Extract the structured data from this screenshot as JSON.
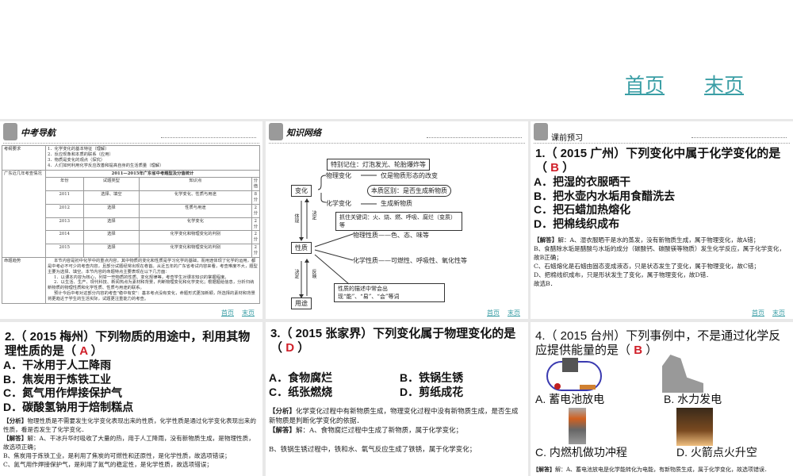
{
  "top_nav": {
    "first": "首页",
    "last": "末页"
  },
  "panel1": {
    "title": "中考导航",
    "req_label": "考纲要求",
    "req_items": [
      "1．化学变化的基本特征（理解）",
      "2．反应现象和本质的联系（应用）",
      "3．物质是变化的观点（探究）",
      "4．人们如何利用化学反应改善和提高自身的生活质量（理解）"
    ],
    "recent_label": "广东近几年考查情况",
    "table_title": "2011—2015年广东省中考题型及分值统计",
    "headers": [
      "年份",
      "试题类型",
      "知识点",
      "分值"
    ],
    "rows": [
      [
        "2011",
        "选择、填空",
        "化学变化、性质与用途",
        "8分"
      ],
      [
        "2012",
        "选择",
        "性质与用途",
        "2分"
      ],
      [
        "2013",
        "选择",
        "化学变化",
        "2分"
      ],
      [
        "2014",
        "选择",
        "化学变化和物理变化的判别",
        "2分"
      ],
      [
        "2015",
        "选择",
        "化学变化和物理变化的判别",
        "2分"
      ]
    ],
    "trend_label": "命题趋势",
    "trend_paras": [
      "本节内容是初中化学中的重点内容，其中物质的变化和性质是学习化学的基础，而用途体现了化学的运用，都是中考必不可少的考查内容，且部分试题经常出现在卷首。从近五年的广东省考试内容来看，考查难度不大，题型主要为选择、填空。本节内容的命题特点主要表现在以下几方面：",
      "1．以课本内容为核心，列举一些物质的性质、变化规律等，考查学生对课本知识的掌握程度。",
      "2．以生活、生产、现代科技、新闻热点为素材和背景，判断物理变化和化学变化；根据题给信息，分析归纳新物质的物理性质和化学性质、性质与用途的联系。",
      "预计今后中考对这部分内容的考查\"稳中有变\"：基本考点没有变化，命题形式更加新颖，所选择的素材和背景将更趋近于学生的生活实际，试题更注重能力的考查。"
    ],
    "nav": {
      "first": "首页",
      "last": "末页"
    }
  },
  "panel2": {
    "title": "知识网络",
    "change": "变化",
    "property": "性质",
    "use": "用途",
    "embody": "体现",
    "decide1": "决定",
    "decide2": "决定",
    "reflect": "反映",
    "remember": "特别记住：灯泡发光、轮胎爆炸等",
    "physical_change": "物理变化",
    "physical_change_desc": "仅是物质形态的改变",
    "essence": "本质区别：是否生成新物质",
    "chemical_change": "化学变化",
    "chemical_change_desc": "生成新物质",
    "keywords": "抓住关键词：火、烧、燃、呼吸、腐烂（变质）等",
    "physical_property": "物理性质——色、态、味等",
    "chemical_property": "化学性质——可燃性、呼吸性、氧化性等",
    "property_desc": "性质的描述中常会出现“能”、“易”、“会”等词",
    "nav": {
      "first": "首页",
      "last": "末页"
    }
  },
  "panel3": {
    "title": "课前预习",
    "question": "1.（ 2015 广州）下列变化中属于化学变化的是",
    "answer": "B",
    "options": [
      "A．把湿的衣服晒干",
      "B．把水壶内水垢用食醋洗去",
      "C．把石蜡加热熔化",
      "D．把棉线织成布"
    ],
    "solution_label": "【解答】",
    "solution": [
      "解：A、湿衣服晒干是水的蒸发，没有新物质生成，属于物理变化，故A错；",
      "B、食醋除水垢是醋酸与水垢的成分（碳酸钙、碳酸镁等物质）发生化学反应，属于化学变化，故B正确；",
      "C、石蜡熔化是石蜡由固态变成液态，只是状态发生了变化，属于物理变化，故C错；",
      "D、把棉线织成布，只是形状发生了变化，属于物理变化，故D错．",
      "故选B．"
    ],
    "nav": {
      "first": "首页",
      "last": "末页"
    }
  },
  "panel4": {
    "question": "2.（ 2015 梅州）下列物质的用途中，利用其物理性质的是（",
    "answer": "A",
    "options": [
      "A．干冰用于人工降雨",
      "B．焦炭用于炼铁工业",
      "C．氮气用作焊接保护气",
      "D．碳酸氢钠用于焙制糕点"
    ],
    "analysis_label": "【分析】",
    "analysis": "物理性质是不需要发生化学变化表现出来的性质，化学性质是通过化学变化表现出来的性质，看是否发生了化学变化．",
    "solution_label": "【解答】",
    "solution": [
      "解：A、干冰升华时吸收了大量的热，用于人工降雨，没有新物质生成，是物理性质，故选项正确；",
      "B、焦炭用于炼铁工业，是利用了焦炭的可燃性和还原性，是化学性质，故选项错误；",
      "C、氮气用作焊接保护气，是利用了氮气的稳定性，是化学性质，故选项错误；"
    ]
  },
  "panel5": {
    "question": "3.（ 2015 张家界）下列变化属于物理变化的是（",
    "answer": "D",
    "options": [
      "A．食物腐烂",
      "B．铁锅生锈",
      "C．纸张燃烧",
      "D．剪纸成花"
    ],
    "analysis_label": "【分析】",
    "analysis": "化学变化过程中有新物质生成，物理变化过程中没有新物质生成，是否生成新物质是判断化学变化的依据．",
    "solution_label": "【解答】",
    "solution": [
      "解：A、食物腐烂过程中生成了新物质，属于化学变化；",
      "B、铁锅生锈过程中，铁和水、氧气反应生成了铁锈，属于化学变化；"
    ]
  },
  "panel6": {
    "question": "4.（ 2015 台州）下列事例中，不是通过化学反应提供能量的是（",
    "answer": "B",
    "options": [
      "A. 蓄电池放电",
      "B. 水力发电",
      "C. 内燃机做功冲程",
      "D. 火箭点火升空"
    ],
    "solution_label": "【解答】",
    "solution": "解：A、蓄电池放电是化学能转化为电能，有新物质生成，属于化学变化，故选项错误．"
  }
}
